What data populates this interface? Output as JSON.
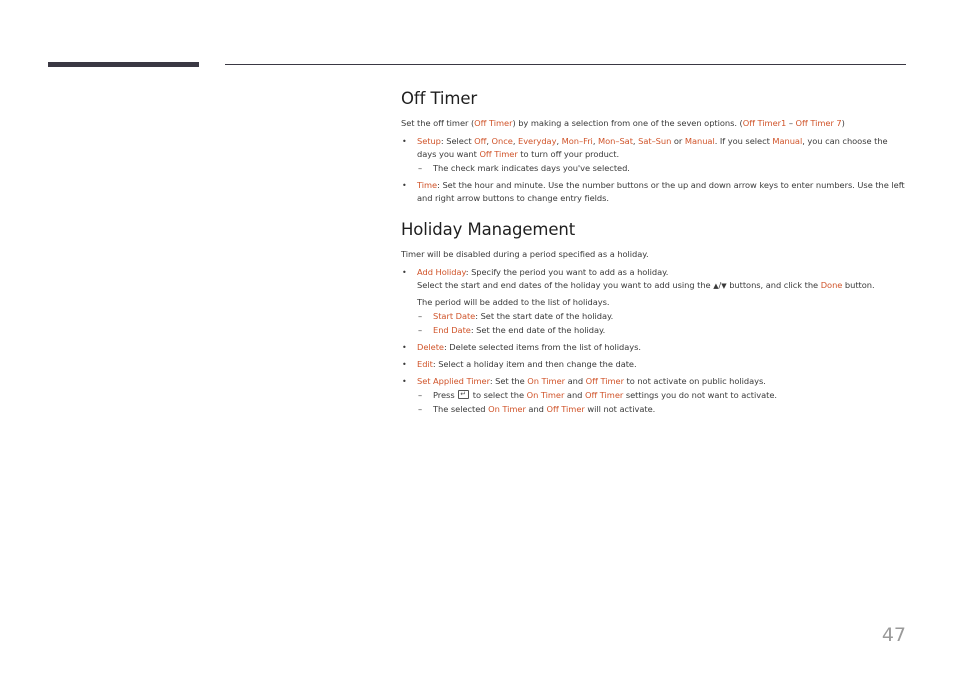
{
  "page_number": "47",
  "off_timer": {
    "title": "Off Timer",
    "intro": {
      "t1": "Set the off timer (",
      "h1": "Off Timer",
      "t2": ") by making a selection from one of the seven options. (",
      "h2": "Off Timer1",
      "t3": " – ",
      "h3": "Off Timer 7",
      "t4": ")"
    },
    "setup": {
      "h_setup": "Setup",
      "t1": ": Select ",
      "off": "Off",
      "c1": ", ",
      "once": "Once",
      "c2": ", ",
      "everyday": "Everyday",
      "c3": ", ",
      "monfri": "Mon–Fri",
      "c4": ", ",
      "monsat": "Mon–Sat",
      "c5": ", ",
      "satsun": "Sat–Sun",
      "t2": " or ",
      "manual": "Manual",
      "t3": ". If you select ",
      "manual2": "Manual",
      "t4": ", you can choose the days you want ",
      "offtimer": "Off Timer",
      "t5": " to turn off your product.",
      "sub": "The check mark indicates days you've selected."
    },
    "time": {
      "h_time": "Time",
      "t1": ": Set the hour and minute. Use the number buttons or the up and down arrow keys to enter numbers. Use the left and right arrow buttons to change entry fields."
    }
  },
  "holiday": {
    "title": "Holiday Management",
    "intro": "Timer will be disabled during a period specified as a holiday.",
    "add": {
      "h_add": "Add Holiday",
      "t1": ": Specify the period you want to add as a holiday.",
      "t2": "Select the start and end dates of the holiday you want to add using the ",
      "arrows_up": "▲",
      "slash": "/",
      "arrows_down": "▼",
      "t3": " buttons, and click the ",
      "done": "Done",
      "t4": " button.",
      "t5": "The period will be added to the list of holidays.",
      "start_h": "Start Date",
      "start_t": ": Set the start date of the holiday.",
      "end_h": "End Date",
      "end_t": ": Set the end date of the holiday."
    },
    "delete": {
      "h": "Delete",
      "t": ": Delete selected items from the list of holidays."
    },
    "edit": {
      "h": "Edit",
      "t": ": Select a holiday item and then change the date."
    },
    "applied": {
      "h": "Set Applied Timer",
      "t1": ": Set the ",
      "on": "On Timer",
      "t2": " and ",
      "off": "Off Timer",
      "t3": " to not activate on public holidays.",
      "s1_t1": "Press ",
      "s1_t2": " to select the ",
      "s1_on": "On Timer",
      "s1_t3": " and ",
      "s1_off": "Off Timer",
      "s1_t4": " settings you do not want to activate.",
      "s2_t1": "The selected ",
      "s2_on": "On Timer",
      "s2_t2": " and ",
      "s2_off": "Off Timer",
      "s2_t3": " will not activate."
    }
  }
}
